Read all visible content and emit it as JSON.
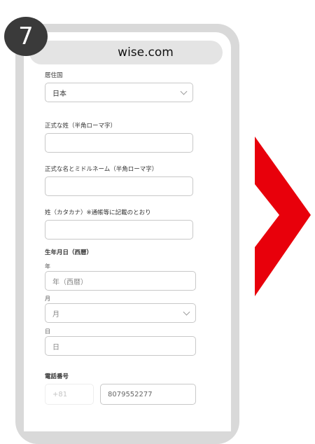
{
  "step": {
    "number": "7"
  },
  "browser": {
    "url": "wise.com"
  },
  "form": {
    "country": {
      "label": "居住国",
      "value": "日本"
    },
    "last_name": {
      "label": "正式な姓（半角ローマ字）",
      "value": ""
    },
    "first_middle_name": {
      "label": "正式な名とミドルネーム（半角ローマ字）",
      "value": ""
    },
    "last_name_kana": {
      "label": "姓（カタカナ）※通帳等に記載のとおり",
      "value": ""
    },
    "dob": {
      "label": "生年月日（西暦）",
      "year_label": "年",
      "year_placeholder": "年（西暦）",
      "month_label": "月",
      "month_value": "月",
      "day_label": "日",
      "day_placeholder": "日"
    },
    "phone": {
      "label": "電話番号",
      "country_code": "+81",
      "number": "8079552277"
    }
  },
  "colors": {
    "accent_arrow": "#e8000b",
    "badge": "#3a3a3a"
  },
  "icons": {
    "select_chevron": "chevron-down-icon",
    "next": "chevron-right-arrow"
  }
}
